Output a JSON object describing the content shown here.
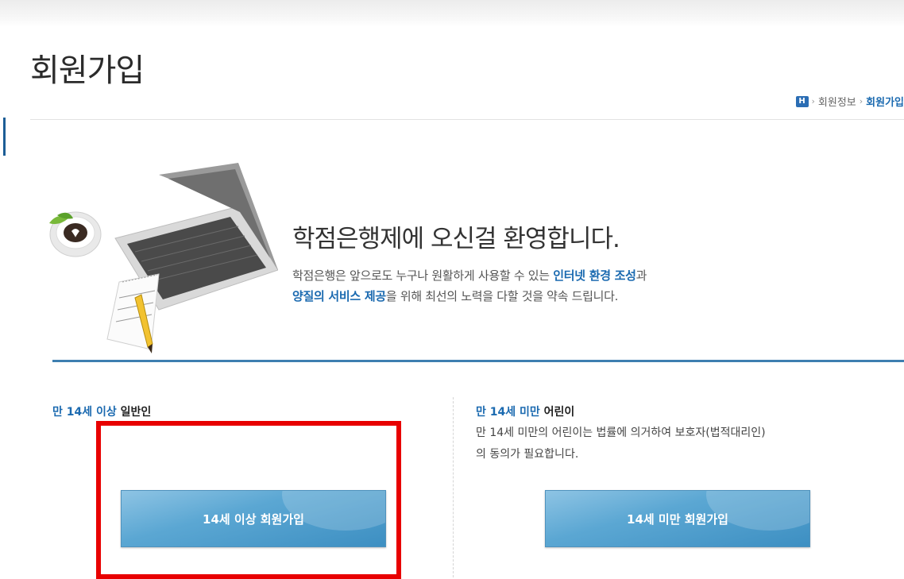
{
  "page": {
    "title": "회원가입"
  },
  "breadcrumb": {
    "home_icon": "H",
    "items": [
      "회원정보",
      "회원가입"
    ]
  },
  "welcome": {
    "heading": "학점은행제에 오신걸 환영합니다.",
    "line1_before": "학점은행은 앞으로도 누구나 원활하게 사용할 수 있는 ",
    "line1_highlight": "인터넷 환경 조성",
    "line1_after": "과",
    "line2_highlight": "양질의 서비스 제공",
    "line2_after": "을 위해 최선의 노력을 다할 것을 약속 드립니다."
  },
  "adult": {
    "title_highlight": "만 14세 이상",
    "title_rest": " 일반인",
    "button": "14세 이상 회원가입"
  },
  "child": {
    "title_highlight": "만 14세 미만",
    "title_rest": " 어린이",
    "note_line1": "만 14세 미만의 어린이는 법률에 의거하여 보호자(법적대리인)",
    "note_line2": "의 동의가 필요합니다.",
    "button": "14세 미만 회원가입"
  },
  "colors": {
    "accent": "#1b6ab0",
    "button": "#5ba7d3",
    "highlight_box": "#e80000"
  }
}
